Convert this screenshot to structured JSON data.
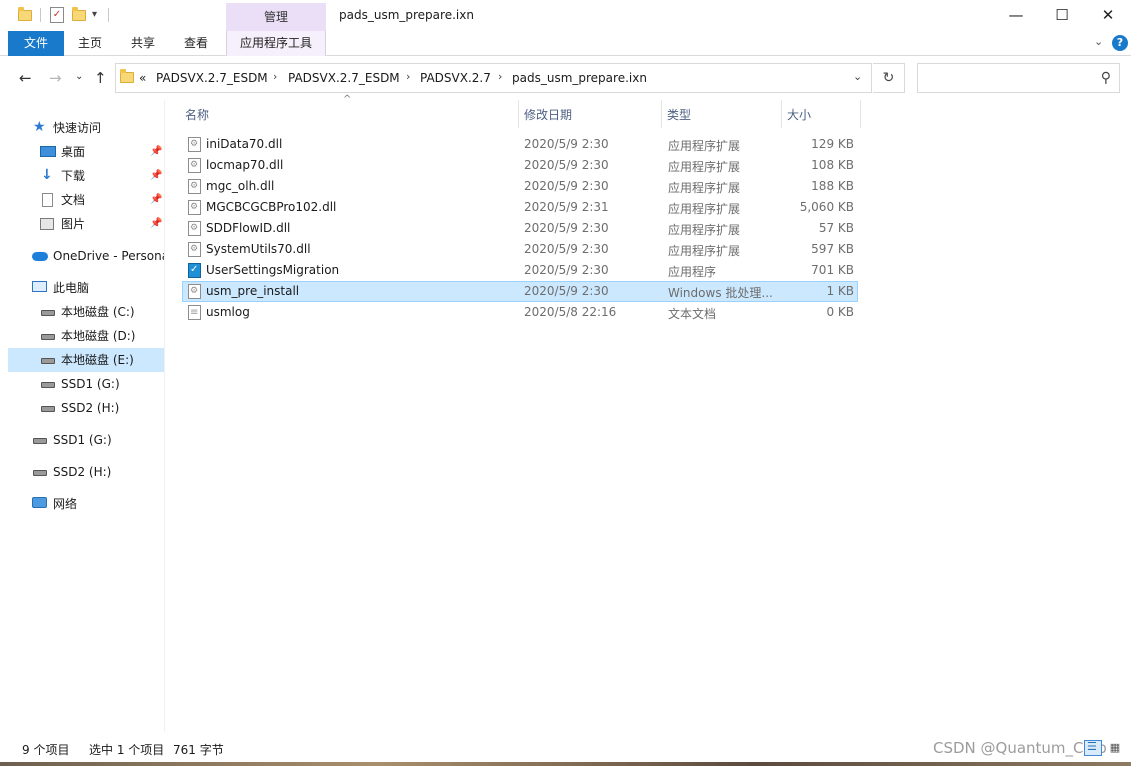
{
  "window": {
    "title": "pads_usm_prepare.ixn",
    "manage_tab": "管理",
    "minimize_glyph": "—",
    "maximize_glyph": "☐",
    "close_glyph": "✕"
  },
  "ribbon": {
    "tabs": [
      "文件",
      "主页",
      "共享",
      "查看",
      "应用程序工具"
    ],
    "expand_glyph": "⌄",
    "help_glyph": "?"
  },
  "nav": {
    "back_glyph": "←",
    "forward_glyph": "→",
    "recent_glyph": "⌄",
    "up_glyph": "↑",
    "address_prefix": "«",
    "breadcrumbs": [
      "PADSVX.2.7_ESDM",
      "PADSVX.2.7_ESDM",
      "PADSVX.2.7",
      "pads_usm_prepare.ixn"
    ],
    "crumb_separator": "›",
    "dropdown_glyph": "⌄",
    "refresh_glyph": "↻",
    "search_placeholder": "",
    "search_glyph": "⚲"
  },
  "sidebar": {
    "items": [
      {
        "label": "快速访问",
        "icon": "star-icon"
      },
      {
        "label": "桌面",
        "icon": "desktop-icon",
        "pinned": true
      },
      {
        "label": "下载",
        "icon": "download-icon",
        "pinned": true
      },
      {
        "label": "文档",
        "icon": "document-icon",
        "pinned": true
      },
      {
        "label": "图片",
        "icon": "pictures-icon",
        "pinned": true
      },
      {
        "label": "OneDrive - Personal",
        "icon": "onedrive-icon"
      },
      {
        "label": "此电脑",
        "icon": "this-pc-icon"
      },
      {
        "label": "本地磁盘 (C:)",
        "icon": "drive-icon"
      },
      {
        "label": "本地磁盘 (D:)",
        "icon": "drive-icon"
      },
      {
        "label": "本地磁盘 (E:)",
        "icon": "drive-icon",
        "selected": true
      },
      {
        "label": "SSD1 (G:)",
        "icon": "drive-icon"
      },
      {
        "label": "SSD2 (H:)",
        "icon": "drive-icon"
      },
      {
        "label": "SSD1 (G:)",
        "icon": "drive-icon"
      },
      {
        "label": "SSD2 (H:)",
        "icon": "drive-icon"
      },
      {
        "label": "网络",
        "icon": "network-icon"
      }
    ],
    "pin_glyph": "📌"
  },
  "columns": {
    "name": "名称",
    "date": "修改日期",
    "type": "类型",
    "size": "大小",
    "sort_glyph": "^"
  },
  "files": [
    {
      "name": "iniData70.dll",
      "date": "2020/5/9 2:30",
      "type": "应用程序扩展",
      "size": "129 KB",
      "icon": "dll-icon"
    },
    {
      "name": "locmap70.dll",
      "date": "2020/5/9 2:30",
      "type": "应用程序扩展",
      "size": "108 KB",
      "icon": "dll-icon"
    },
    {
      "name": "mgc_olh.dll",
      "date": "2020/5/9 2:30",
      "type": "应用程序扩展",
      "size": "188 KB",
      "icon": "dll-icon"
    },
    {
      "name": "MGCBCGCBPro102.dll",
      "date": "2020/5/9 2:31",
      "type": "应用程序扩展",
      "size": "5,060 KB",
      "icon": "dll-icon"
    },
    {
      "name": "SDDFlowID.dll",
      "date": "2020/5/9 2:30",
      "type": "应用程序扩展",
      "size": "57 KB",
      "icon": "dll-icon"
    },
    {
      "name": "SystemUtils70.dll",
      "date": "2020/5/9 2:30",
      "type": "应用程序扩展",
      "size": "597 KB",
      "icon": "dll-icon"
    },
    {
      "name": "UserSettingsMigration",
      "date": "2020/5/9 2:30",
      "type": "应用程序",
      "size": "701 KB",
      "icon": "app-icon"
    },
    {
      "name": "usm_pre_install",
      "date": "2020/5/9 2:30",
      "type": "Windows 批处理...",
      "size": "1 KB",
      "icon": "batch-icon",
      "selected": true
    },
    {
      "name": "usmlog",
      "date": "2020/5/8 22:16",
      "type": "文本文档",
      "size": "0 KB",
      "icon": "text-file-icon"
    }
  ],
  "status": {
    "item_count": "9 个项目",
    "selection": "选中 1 个项目",
    "selection_size": "761 字节"
  },
  "watermark": "CSDN @Quantum_Chip"
}
